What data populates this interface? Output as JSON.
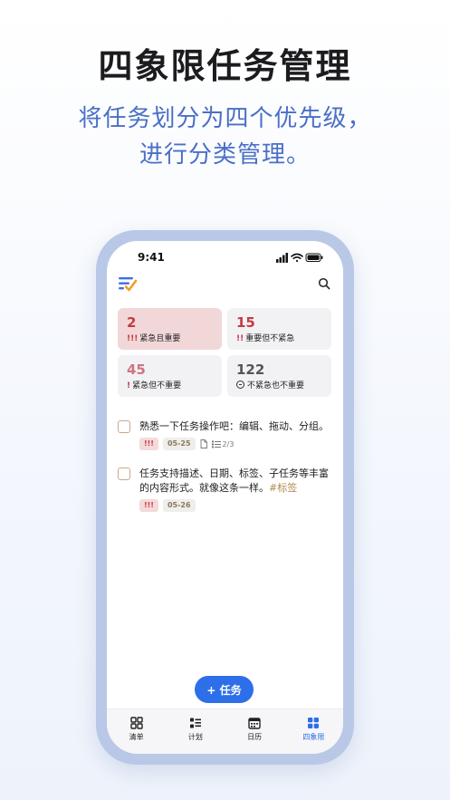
{
  "promo": {
    "headline": "四象限任务管理",
    "subline_1": "将任务划分为四个优先级，",
    "subline_2": "进行分类管理。"
  },
  "status_bar": {
    "time": "9:41"
  },
  "quadrants": [
    {
      "count": "2",
      "mark": "!!!",
      "label": "紧急且重要"
    },
    {
      "count": "15",
      "mark": "!!",
      "label": "重要但不紧急"
    },
    {
      "count": "45",
      "mark": "!",
      "label": "紧急但不重要"
    },
    {
      "count": "122",
      "mark": "",
      "label": "不紧急也不重要"
    }
  ],
  "tasks": [
    {
      "title": "熟悉一下任务操作吧：编辑、拖动、分组。",
      "priority": "!!!",
      "date": "05-25",
      "subtasks": "2/3"
    },
    {
      "title": "任务支持描述、日期、标签、子任务等丰富的内容形式。就像这条一样。",
      "tag": "#标签",
      "priority": "!!!",
      "date": "05-26"
    }
  ],
  "add_button": "+ 任务",
  "tabs": [
    {
      "label": "清单",
      "icon": "grid-icon"
    },
    {
      "label": "计划",
      "icon": "list-icon"
    },
    {
      "label": "日历",
      "icon": "calendar-icon"
    },
    {
      "label": "四象限",
      "icon": "quadrant-icon",
      "active": true
    }
  ],
  "colors": {
    "accent": "#2d6fe8",
    "urgent_red": "#c43a43",
    "q1_bg": "#f2d7d9",
    "card_bg": "#f2f2f5",
    "headline_blue": "#4a6fc7",
    "frame": "#b9c8e6"
  }
}
